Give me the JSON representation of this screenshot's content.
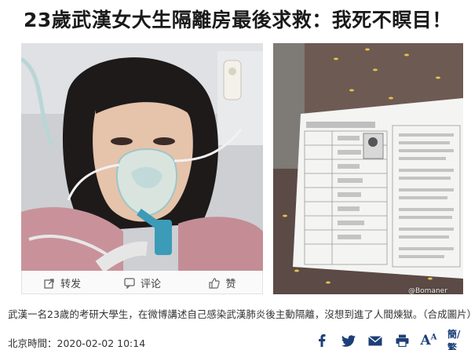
{
  "headline": "23歲武漢女大生隔離房最後求救：我死不瞑目！",
  "actions": {
    "share_label": "转发",
    "comment_label": "评论",
    "like_label": "赞"
  },
  "watermark": "@Bomaner",
  "caption": "武漢一名23歲的考研大學生，在微博講述自己感染武漢肺炎後主動隔離，沒想到進了人間煉獄。（合成圖片）",
  "footer": {
    "timestamp": "北京時間：2020-02-02 10:14",
    "simplified_label": "簡/繁"
  },
  "colors": {
    "accent": "#1c3f78"
  }
}
